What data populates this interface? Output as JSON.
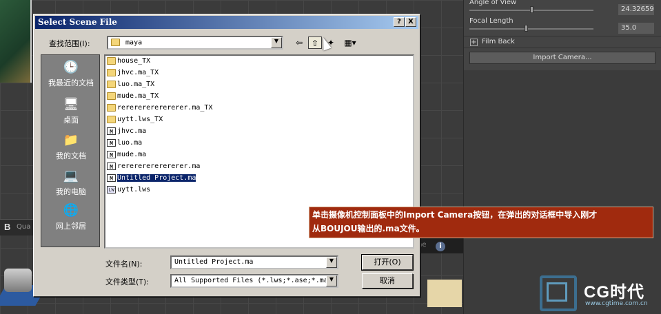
{
  "background": {
    "viewport_letter": "B",
    "viewport_label": "Qua",
    "strip_text": "ne",
    "info_icon_glyph": "i"
  },
  "panel": {
    "angle_label": "Angle of View",
    "angle_value": "24.32659",
    "focal_label": "Focal Length",
    "focal_value": "35.0",
    "film_back_toggle": "+",
    "film_back_label": "Film Back",
    "import_button": "Import Camera..."
  },
  "dialog": {
    "title": "Select Scene File",
    "help_button": "?",
    "close_button": "X",
    "look_in_label": "查找范围(I):",
    "look_in_value": "maya",
    "places": [
      {
        "label": "我最近的文档",
        "icon": "recent-documents-icon"
      },
      {
        "label": "桌面",
        "icon": "desktop-icon"
      },
      {
        "label": "我的文档",
        "icon": "my-documents-icon"
      },
      {
        "label": "我的电脑",
        "icon": "my-computer-icon"
      },
      {
        "label": "网上邻居",
        "icon": "network-places-icon"
      }
    ],
    "files": [
      {
        "name": "house_TX",
        "type": "folder"
      },
      {
        "name": "jhvc.ma_TX",
        "type": "folder"
      },
      {
        "name": "luo.ma_TX",
        "type": "folder"
      },
      {
        "name": "mude.ma_TX",
        "type": "folder"
      },
      {
        "name": "rerererererererer.ma_TX",
        "type": "folder"
      },
      {
        "name": "uytt.lws_TX",
        "type": "folder"
      },
      {
        "name": "jhvc.ma",
        "type": "ma"
      },
      {
        "name": "luo.ma",
        "type": "ma"
      },
      {
        "name": "mude.ma",
        "type": "ma"
      },
      {
        "name": "rerererererererer.ma",
        "type": "ma"
      },
      {
        "name": "Untitled Project.ma",
        "type": "ma",
        "selected": true
      },
      {
        "name": "uytt.lws",
        "type": "lws"
      }
    ],
    "filename_label": "文件名(N):",
    "filename_value": "Untitled Project.ma",
    "filetype_label": "文件类型(T):",
    "filetype_value": "All Supported Files (*.lws;*.ase;*.ma",
    "open_button": "打开(O)",
    "cancel_button": "取消"
  },
  "annotation": {
    "line1": "单击摄像机控制面板中的Import Camera按钮，在弹出的对话框中导入刚才",
    "line2": "从BOUJOU输出的.ma文件。"
  },
  "watermark": {
    "name": "CG时代",
    "url": "www.cgtime.com.cn"
  },
  "colors": {
    "titlebar_start": "#0a246a",
    "titlebar_end": "#a6caf0",
    "annotation_bg": "#a02a0e",
    "selection": "#0a246a"
  }
}
